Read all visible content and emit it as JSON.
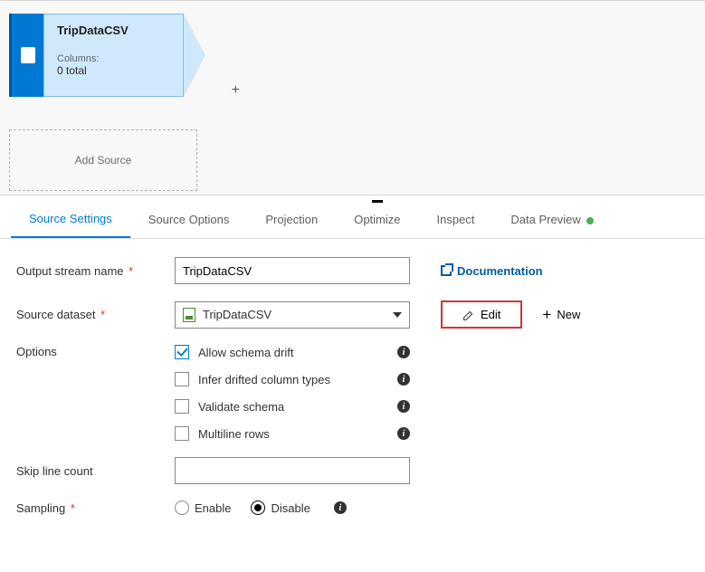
{
  "canvas": {
    "node_title": "TripDataCSV",
    "columns_label": "Columns:",
    "columns_total": "0 total",
    "plus": "+",
    "add_source": "Add Source"
  },
  "tabs": {
    "items": [
      "Source Settings",
      "Source Options",
      "Projection",
      "Optimize",
      "Inspect",
      "Data Preview"
    ]
  },
  "panel": {
    "output_stream_label": "Output stream name",
    "output_stream_value": "TripDataCSV",
    "source_dataset_label": "Source dataset",
    "source_dataset_value": "TripDataCSV",
    "documentation": "Documentation",
    "edit": "Edit",
    "new": "New",
    "options_label": "Options",
    "options": [
      {
        "label": "Allow schema drift",
        "checked": true
      },
      {
        "label": "Infer drifted column types",
        "checked": false
      },
      {
        "label": "Validate schema",
        "checked": false
      },
      {
        "label": "Multiline rows",
        "checked": false
      }
    ],
    "skip_line_label": "Skip line count",
    "skip_line_value": "",
    "sampling_label": "Sampling",
    "sampling_enable": "Enable",
    "sampling_disable": "Disable"
  }
}
